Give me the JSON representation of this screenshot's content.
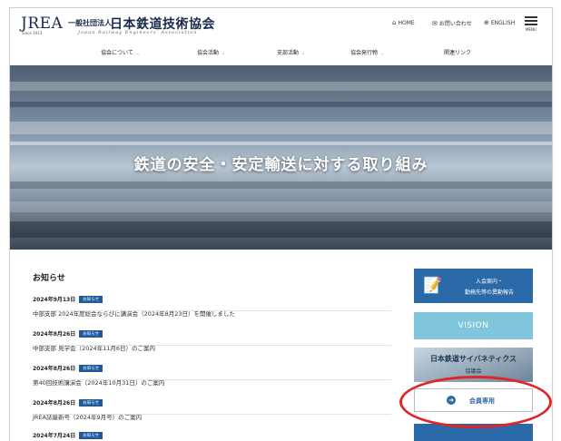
{
  "header": {
    "logo_latin": "JREA",
    "logo_since": "Since 1913",
    "logo_prefix": "一般社団法人",
    "logo_name": "日本鉄道技術協会",
    "logo_english": "Japan Railway Engineers' Association",
    "links": [
      {
        "icon": "home-icon",
        "label": "HOME"
      },
      {
        "icon": "mail-icon",
        "label": "お問い合わせ"
      },
      {
        "icon": "globe-icon",
        "label": "ENGLISH"
      }
    ],
    "menu_label": "MENU"
  },
  "nav": {
    "items": [
      {
        "label": "協会について",
        "dropdown": true
      },
      {
        "label": "協会活動",
        "dropdown": true
      },
      {
        "label": "支部活動",
        "dropdown": true
      },
      {
        "label": "協会発行物",
        "dropdown": true
      },
      {
        "label": "関連リンク",
        "dropdown": false
      }
    ]
  },
  "hero": {
    "title": "鉄道の安全・安定輸送に対する取り組み"
  },
  "news": {
    "title": "お知らせ",
    "items": [
      {
        "date": "2024年9月13日",
        "badge": "お知らせ",
        "text": "中部支部 2024年度総会ならびに講演会（2024年8月23日）を開催しました"
      },
      {
        "date": "2024年8月26日",
        "badge": "お知らせ",
        "text": "中部支部 見学会（2024年11月6日）のご案内"
      },
      {
        "date": "2024年8月26日",
        "badge": "お知らせ",
        "text": "第40回技術講演会（2024年10月31日）のご案内"
      },
      {
        "date": "2024年8月26日",
        "badge": "お知らせ",
        "text": "JREA誌最新号（2024年9月号）のご案内"
      },
      {
        "date": "2024年7月24日",
        "badge": "お知らせ",
        "text": ""
      }
    ]
  },
  "sidebar": {
    "join_icon": "document-pen-icon",
    "join_line1": "入会案内・",
    "join_line2": "勤務先等の異動報告",
    "vision": "VISION",
    "cyber_line1": "日本鉄道サイバネティクス",
    "cyber_line2": "協議会",
    "members_icon": "arrow-circle-icon",
    "members": "会員専用"
  },
  "colors": {
    "brand_blue": "#2b6aa9",
    "badge_blue": "#1e5a9c",
    "vision_cyan": "#7fc6dc",
    "highlight_red": "#e0252b"
  }
}
